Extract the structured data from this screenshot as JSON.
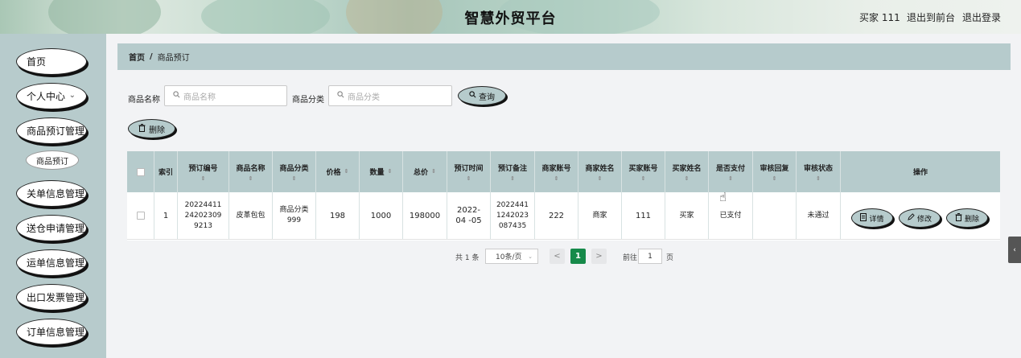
{
  "header": {
    "title": "智慧外贸平台",
    "user": "买家 111",
    "back_to_front": "退出到前台",
    "logout": "退出登录"
  },
  "sidebar": {
    "items": [
      {
        "label": "首页"
      },
      {
        "label": "个人中心",
        "chevron": "⌄"
      },
      {
        "label": "商品预订管理"
      },
      {
        "label": "关单信息管理"
      },
      {
        "label": "送仓申请管理"
      },
      {
        "label": "运单信息管理"
      },
      {
        "label": "出口发票管理"
      },
      {
        "label": "订单信息管理"
      }
    ],
    "sub_item": "商品预订"
  },
  "breadcrumb": {
    "home": "首页",
    "sep": "/",
    "current": "商品预订"
  },
  "search": {
    "name_label": "商品名称",
    "name_placeholder": "商品名称",
    "category_label": "商品分类",
    "category_placeholder": "商品分类",
    "query_button": "查询"
  },
  "toolbar": {
    "delete_button": "删除"
  },
  "table": {
    "headers": {
      "index": "索引",
      "order_no": "预订编号",
      "product_name": "商品名称",
      "category": "商品分类",
      "price": "价格",
      "quantity": "数量",
      "total": "总价",
      "order_time": "预订时间",
      "remark": "预订备注",
      "merchant_account": "商家账号",
      "merchant_name": "商家姓名",
      "buyer_account": "买家账号",
      "buyer_name": "买家姓名",
      "paid": "是否支付",
      "review_reply": "审核回复",
      "review_status": "审核状态",
      "actions": "操作"
    },
    "rows": [
      {
        "index": "1",
        "order_no": "20224411 24202309 9213",
        "product_name": "皮革包包",
        "category": "商品分类 999",
        "price": "198",
        "quantity": "1000",
        "total": "198000",
        "order_time": "2022-04 -05",
        "remark": "2022441 1242023 087435",
        "merchant_account": "222",
        "merchant_name": "商家",
        "buyer_account": "111",
        "buyer_name": "买家",
        "paid": "已支付",
        "review_reply": "",
        "review_status": "未通过"
      }
    ],
    "row_actions": {
      "detail": "详情",
      "edit": "修改",
      "delete": "删除"
    }
  },
  "pagination": {
    "total": "共 1 条",
    "page_size": "10条/页",
    "prev": "<",
    "current_page": "1",
    "next": ">",
    "goto_label": "前往",
    "goto_value": "1",
    "page_unit": "页"
  },
  "icons": {
    "search": "search-icon",
    "delete": "trash-icon",
    "detail": "document-icon",
    "edit": "pencil-icon",
    "chevron": "chevron-down-icon",
    "sort": "sort-icon",
    "collapse": "chevron-left-icon",
    "cursor": "hand-cursor-icon"
  },
  "colors": {
    "accent": "#b6cbcc",
    "active_page": "#168a4a"
  }
}
